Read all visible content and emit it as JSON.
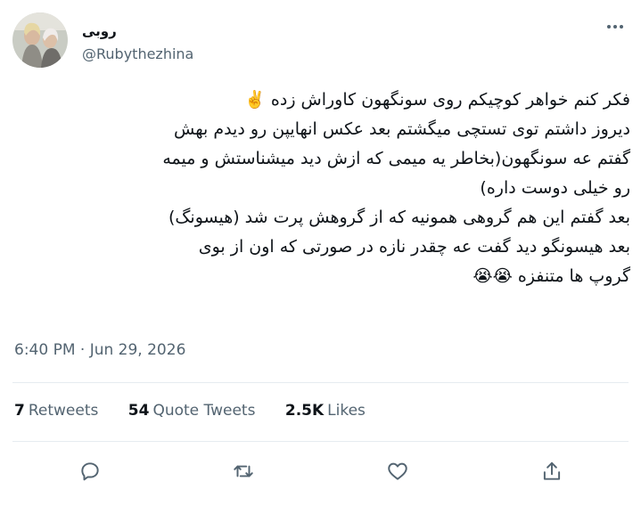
{
  "author": {
    "display_name": "روبی",
    "handle": "@Rubythezhina",
    "avatar_icon": "profile-photo"
  },
  "tweet": {
    "lines": [
      "فکر کنم خواهر کوچیکم روی سونگهون کاوراش زده ✌️",
      "دیروز داشتم توی تستچی میگشتم بعد عکس انهایپن رو دیدم بهش",
      "گفتم عه سونگهون(بخاطر یه میمی که ازش دید میشناستش و میمه",
      "رو خیلی دوست داره)",
      "بعد گفتم این هم گروهی همونیه که از گروهش پرت شد (هیسونگ)",
      "بعد هیسونگو دید گفت عه چقدر نازه در صورتی که اون از بوی",
      "گروپ ها متنفزه 😭😭"
    ],
    "timestamp": "6:40 PM · Jun 29, 2026"
  },
  "stats": {
    "retweets_count": "7",
    "retweets_label": "Retweets",
    "quotes_count": "54",
    "quotes_label": "Quote Tweets",
    "likes_count": "2.5K",
    "likes_label": "Likes"
  },
  "actions": [
    "reply-icon",
    "retweet-icon",
    "like-icon",
    "share-icon"
  ],
  "colors": {
    "text": "#0f1419",
    "secondary": "#536471",
    "divider": "#e6ecf0"
  }
}
